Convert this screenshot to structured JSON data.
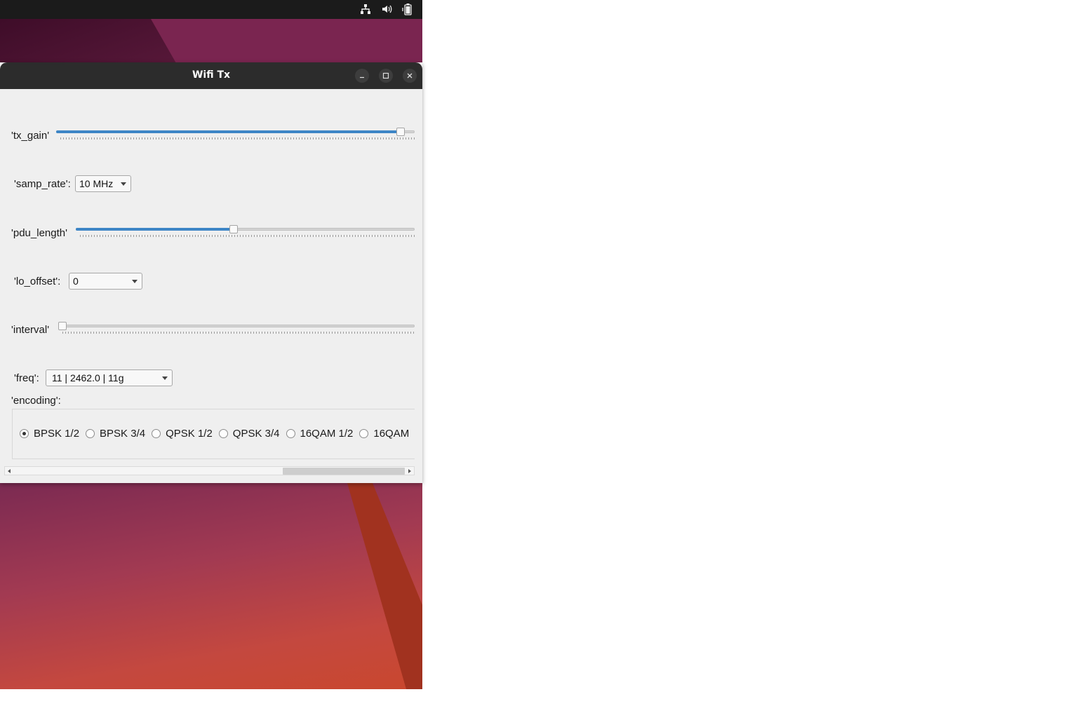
{
  "window": {
    "title": "Wifi Tx"
  },
  "tray": {
    "icons": [
      "network-icon",
      "volume-icon",
      "battery-icon"
    ]
  },
  "controls": {
    "tx_gain": {
      "label": "'tx_gain'",
      "value_fraction": 0.98
    },
    "samp_rate": {
      "label": "'samp_rate':",
      "value": "10 MHz"
    },
    "pdu_length": {
      "label": "'pdu_length'",
      "value_fraction": 0.47
    },
    "lo_offset": {
      "label": "'lo_offset':",
      "value": "0"
    },
    "interval": {
      "label": "'interval'",
      "value_fraction": 0.0
    },
    "freq": {
      "label": "'freq':",
      "value": "11 | 2462.0 | 11g"
    },
    "encoding": {
      "label": "'encoding':",
      "options": [
        "BPSK 1/2",
        "BPSK 3/4",
        "QPSK 1/2",
        "QPSK 3/4",
        "16QAM 1/2",
        "16QAM"
      ],
      "selected_index": 0
    }
  },
  "colors": {
    "accent": "#3d85c6",
    "titlebar": "#2c2c2c",
    "window_bg": "#efefef"
  }
}
